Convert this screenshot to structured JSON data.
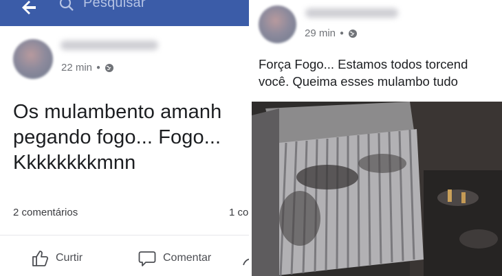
{
  "left": {
    "search_placeholder": "Pesquisar",
    "time": "22 min",
    "post_lines": [
      "Os mulambento amanh",
      "pegando fogo... Fogo...",
      "Kkkkkkkkmnn"
    ],
    "comments": "2 comentários",
    "shares": "1 co",
    "actions": {
      "like": "Curtir",
      "comment": "Comentar"
    }
  },
  "right": {
    "time": "29 min",
    "post_lines": [
      "Força Fogo... Estamos todos torcend",
      "você. Queima esses mulambo tudo"
    ]
  },
  "colors": {
    "topbar": "#3b5ca8",
    "meta_text": "#707378"
  },
  "icons": [
    "back-arrow-icon",
    "search-icon",
    "globe-icon",
    "like-icon",
    "comment-icon"
  ]
}
